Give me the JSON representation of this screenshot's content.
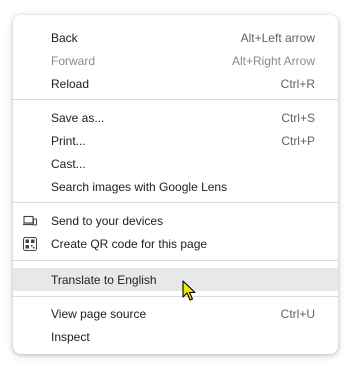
{
  "menu": {
    "items": [
      {
        "label": "Back",
        "shortcut": "Alt+Left arrow"
      },
      {
        "label": "Forward",
        "shortcut": "Alt+Right Arrow"
      },
      {
        "label": "Reload",
        "shortcut": "Ctrl+R"
      },
      {
        "label": "Save as...",
        "shortcut": "Ctrl+S"
      },
      {
        "label": "Print...",
        "shortcut": "Ctrl+P"
      },
      {
        "label": "Cast...",
        "shortcut": ""
      },
      {
        "label": "Search images with Google Lens",
        "shortcut": ""
      },
      {
        "label": "Send to your devices",
        "shortcut": "",
        "icon": "devices-icon"
      },
      {
        "label": "Create QR code for this page",
        "shortcut": "",
        "icon": "qr-code-icon"
      },
      {
        "label": "Translate to English",
        "shortcut": ""
      },
      {
        "label": "View page source",
        "shortcut": "Ctrl+U"
      },
      {
        "label": "Inspect",
        "shortcut": ""
      }
    ]
  },
  "colors": {
    "text": "#202124",
    "disabled_text": "#8a8a8a",
    "highlight": "#e8e8e8",
    "separator": "#dcdcdc",
    "cursor": "#f5e60a"
  }
}
